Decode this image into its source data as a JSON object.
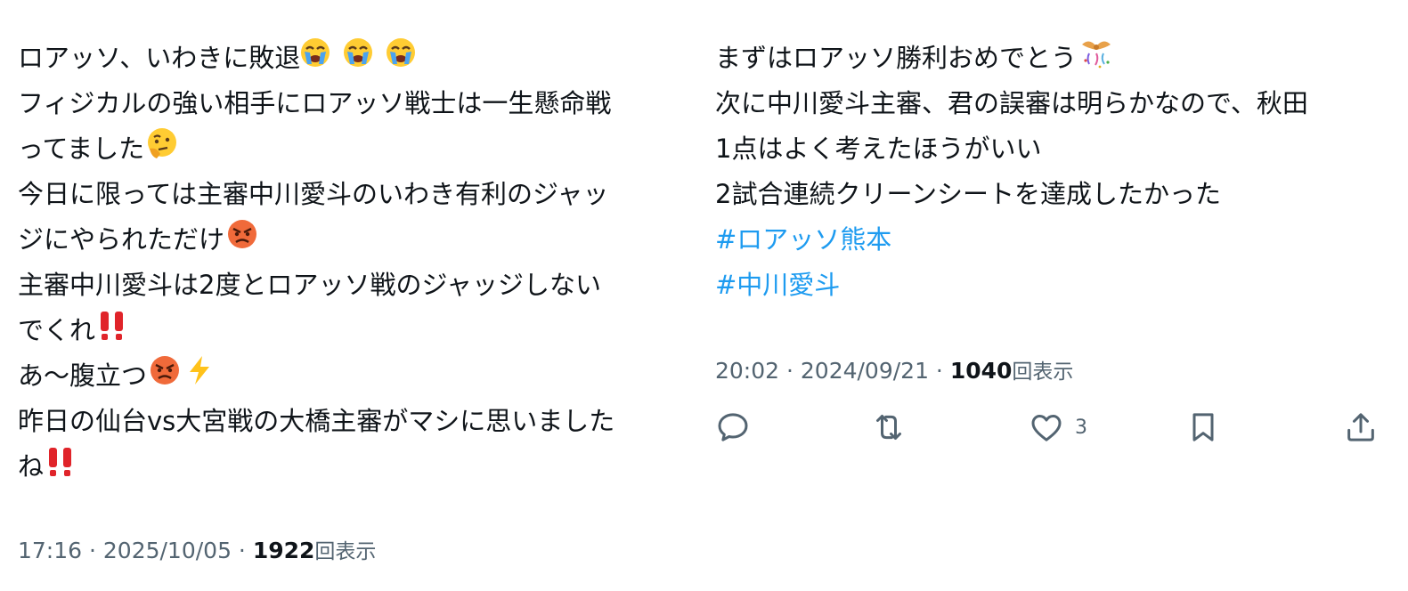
{
  "tweet_left": {
    "lines": [
      "ロアッソ、いわきに敗退",
      "フィジカルの強い相手にロアッソ戦士は一生懸命戦",
      "ってました",
      "今日に限っては主審中川愛斗のいわき有利のジャッ",
      "ジにやられただけ",
      "主審中川愛斗は2度とロアッソ戦のジャッジしない",
      "でくれ",
      "あ〜腹立つ",
      "昨日の仙台vs大宮戦の大橋主審がマシに思いました",
      "ね"
    ],
    "timestamp": "17:16 · 2025/10/05 · ",
    "views_count": "1922",
    "views_label": "回表示"
  },
  "tweet_right": {
    "lines": [
      "まずはロアッソ勝利おめでとう",
      "次に中川愛斗主審、君の誤審は明らかなので、秋田",
      "1点はよく考えたほうがいい",
      "2試合連続クリーンシートを達成したかった"
    ],
    "hashtags": [
      "#ロアッソ熊本",
      "#中川愛斗"
    ],
    "timestamp": "20:02 · 2024/09/21 · ",
    "views_count": "1040",
    "views_label": "回表示",
    "actions": {
      "reply_icon": "reply-icon",
      "retweet_icon": "retweet-icon",
      "like_icon": "heart-icon",
      "like_count": "3",
      "bookmark_icon": "bookmark-icon",
      "share_icon": "share-icon"
    }
  },
  "colors": {
    "text": "#0f1419",
    "secondary": "#536471",
    "link": "#1d9bf0"
  }
}
